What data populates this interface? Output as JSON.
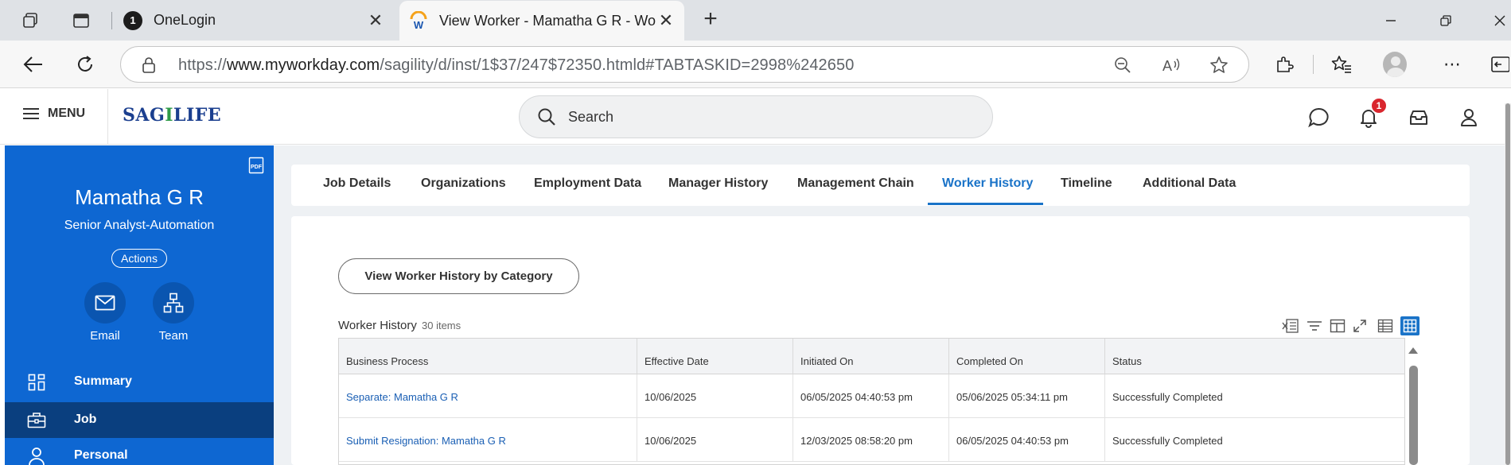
{
  "browser": {
    "tabs": [
      {
        "title": "OneLogin",
        "favicon": "onelogin-icon",
        "active": false
      },
      {
        "title": "View Worker - Mamatha G R - Wo",
        "favicon": "workday-icon",
        "active": true
      }
    ],
    "url_prefix": "https://",
    "url_host": "www.myworkday.com",
    "url_path": "/sagility/d/inst/1$37/247$72350.htmld#TABTASKID=2998%242650"
  },
  "header": {
    "menu_label": "MENU",
    "logo_text_a": "SAG",
    "logo_text_o": "I",
    "logo_text_b": "LIFE",
    "search_placeholder": "Search",
    "notification_count": "1"
  },
  "sidebar": {
    "name": "Mamatha G R",
    "job_title": "Senior Analyst-Automation",
    "actions_label": "Actions",
    "quick_links": [
      {
        "label": "Email",
        "icon": "mail-icon"
      },
      {
        "label": "Team",
        "icon": "org-chart-icon"
      }
    ],
    "nav": [
      {
        "label": "Summary",
        "icon": "grid-icon",
        "selected": false
      },
      {
        "label": "Job",
        "icon": "briefcase-icon",
        "selected": true
      },
      {
        "label": "Personal",
        "icon": "person-icon",
        "selected": false
      }
    ]
  },
  "main": {
    "tabs": [
      {
        "label": "Job Details"
      },
      {
        "label": "Organizations"
      },
      {
        "label": "Employment Data"
      },
      {
        "label": "Manager History"
      },
      {
        "label": "Management Chain"
      },
      {
        "label": "Worker History",
        "active": true
      },
      {
        "label": "Timeline"
      },
      {
        "label": "Additional Data"
      }
    ],
    "category_button": "View Worker History by Category",
    "section_title": "Worker History",
    "item_count": "30 items",
    "table": {
      "columns": [
        "Business Process",
        "Effective Date",
        "Initiated On",
        "Completed On",
        "Status"
      ],
      "rows": [
        [
          "Separate: Mamatha G R",
          "10/06/2025",
          "06/05/2025 04:40:53 pm",
          "05/06/2025 05:34:11 pm",
          "Successfully Completed"
        ],
        [
          "Submit Resignation: Mamatha G R",
          "10/06/2025",
          "12/03/2025 08:58:20 pm",
          "06/05/2025 04:40:53 pm",
          "Successfully Completed"
        ]
      ]
    }
  },
  "colors": {
    "sidebar_blue": "#0e67d2",
    "sidebar_selected": "#0a3f7f",
    "accent_blue": "#1a73c8",
    "badge_red": "#d9262e"
  }
}
